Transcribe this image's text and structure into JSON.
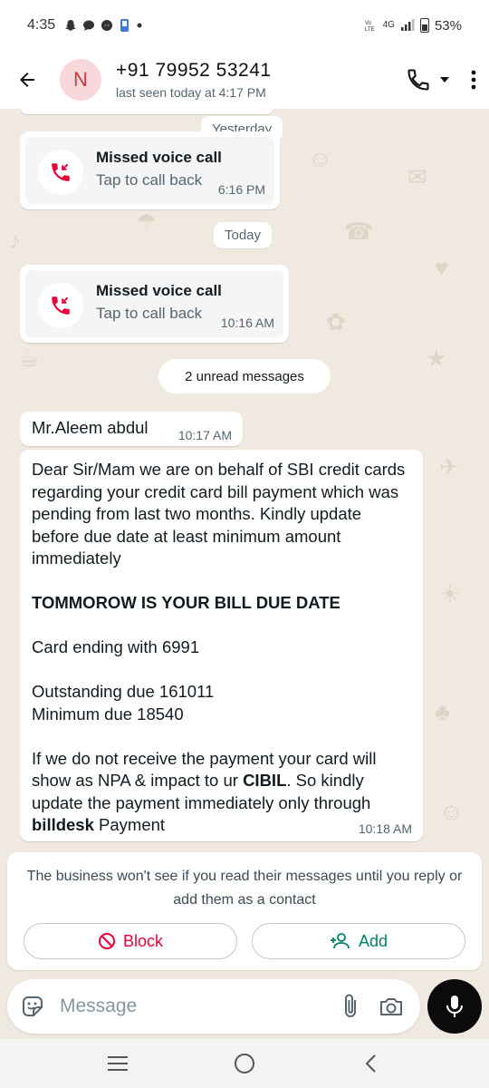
{
  "status_bar": {
    "time": "4:35",
    "network": "4G",
    "battery": "53%"
  },
  "header": {
    "avatar_letter": "N",
    "contact": "+91 79952 53241",
    "last_seen": "last seen today at 4:17 PM"
  },
  "chat": {
    "date_yesterday": "Yesterday",
    "date_today": "Today",
    "missed_calls": [
      {
        "title": "Missed voice call",
        "subtitle": "Tap to call back",
        "time": "6:16 PM"
      },
      {
        "title": "Missed voice call",
        "subtitle": "Tap to call back",
        "time": "10:16 AM"
      }
    ],
    "unread_label": "2 unread messages",
    "messages": [
      {
        "text": "Mr.Aleem abdul",
        "time": "10:17 AM"
      },
      {
        "time": "10:18 AM",
        "p1": "Dear Sir/Mam we are on behalf of SBI credit cards regarding your credit card bill payment which was pending from last two months. Kindly update before due date at least minimum amount immediately",
        "p2": "TOMMOROW IS YOUR BILL DUE DATE",
        "p3": "Card ending with 6991",
        "p4_line1": "Outstanding due 161011",
        "p4_line2": "Minimum due 18540",
        "p5_a": "If we do not receive the payment your card will show as NPA & impact to ur ",
        "p5_bold1": "CIBIL",
        "p5_b": ". So kindly update the payment immediately only through ",
        "p5_bold2": "billdesk",
        "p5_c": " Payment"
      }
    ]
  },
  "notice": {
    "text": "The business won't see if you read their messages until you reply or add them as a contact",
    "block_label": "Block",
    "add_label": "Add"
  },
  "composer": {
    "placeholder": "Message"
  },
  "colors": {
    "accent_green": "#008069",
    "danger_red": "#ea0038",
    "chat_background": "#efe9df"
  },
  "icons": [
    "back-arrow-icon",
    "phone-icon",
    "dropdown-icon",
    "more-vert-icon",
    "missed-call-icon",
    "block-icon",
    "add-contact-icon",
    "sticker-icon",
    "attach-icon",
    "camera-icon",
    "mic-icon"
  ]
}
